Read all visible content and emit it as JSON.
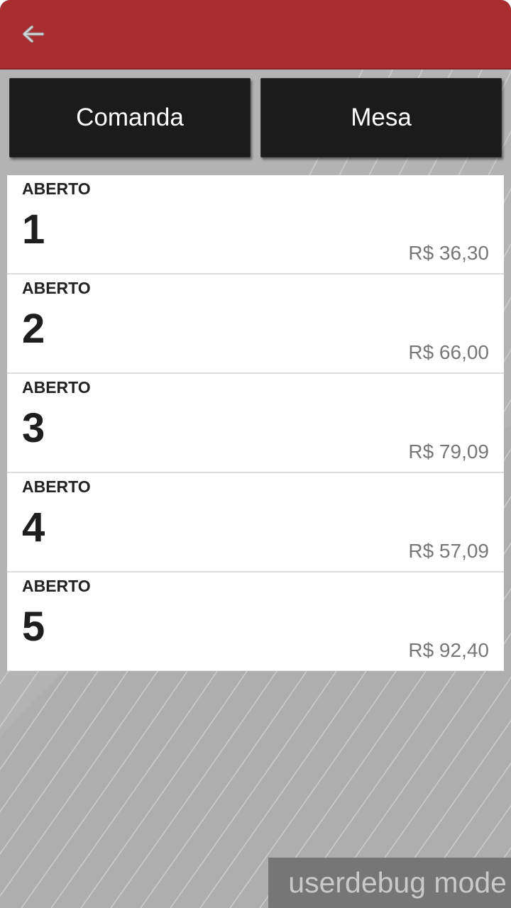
{
  "colors": {
    "header": "#a82d31",
    "background": "#b3b3b3",
    "tab_button": "#1b1b1b"
  },
  "header": {
    "back_icon": "arrow-left-icon"
  },
  "tabs": {
    "comanda": "Comanda",
    "mesa": "Mesa"
  },
  "orders": [
    {
      "status": "ABERTO",
      "number": "1",
      "price": "R$ 36,30"
    },
    {
      "status": "ABERTO",
      "number": "2",
      "price": "R$ 66,00"
    },
    {
      "status": "ABERTO",
      "number": "3",
      "price": "R$ 79,09"
    },
    {
      "status": "ABERTO",
      "number": "4",
      "price": "R$ 57,09"
    },
    {
      "status": "ABERTO",
      "number": "5",
      "price": "R$ 92,40"
    }
  ],
  "debug_banner": "userdebug mode"
}
